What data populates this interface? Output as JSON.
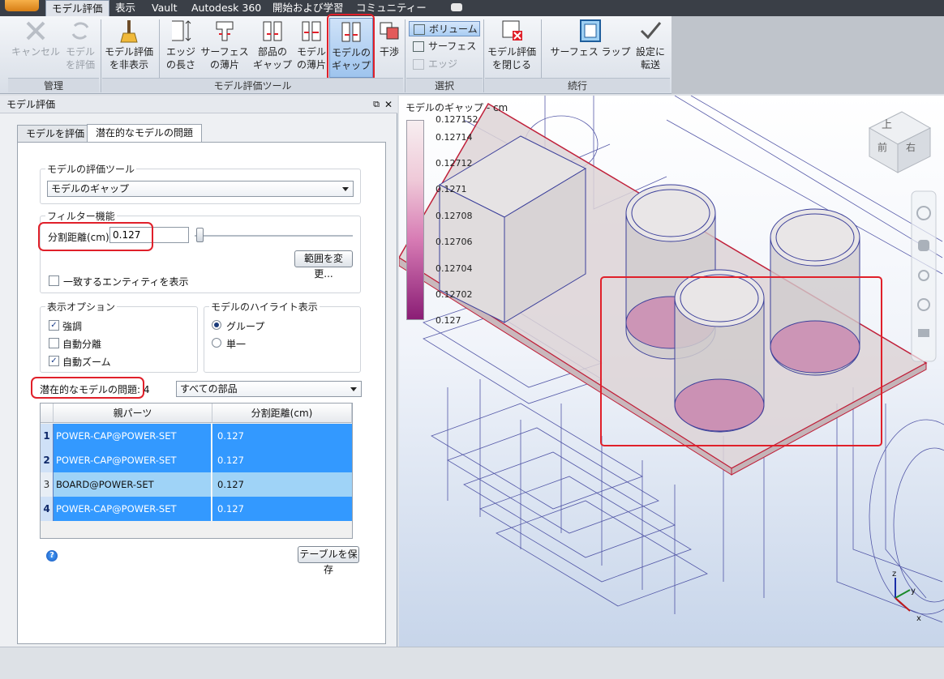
{
  "ribbon": {
    "tabs": [
      "モデル評価",
      "表示",
      "Vault",
      "Autodesk 360",
      "開始および学習",
      "コミュニティー"
    ],
    "buttons": {
      "cancel": "キャンセル",
      "evaluate_model_1": "モデル",
      "evaluate_model_2": "を評価",
      "hide_eval_1": "モデル評価",
      "hide_eval_2": "を非表示",
      "edge_length_1": "エッジ",
      "edge_length_2": "の長さ",
      "surface_thin_1": "サーフェス",
      "surface_thin_2": "の薄片",
      "part_gap_1": "部品の",
      "part_gap_2": "ギャップ",
      "model_thin_1": "モデル",
      "model_thin_2": "の薄片",
      "model_gap_1": "モデルの",
      "model_gap_2": "ギャップ",
      "interference": "干渉",
      "volume": "ボリューム",
      "surface": "サーフェス",
      "edge": "エッジ",
      "close_eval_1": "モデル評価",
      "close_eval_2": "を閉じる",
      "surface_wrap": "サーフェス ラップ",
      "transfer_1": "設定に",
      "transfer_2": "転送"
    },
    "groups": {
      "manage": "管理",
      "tools": "モデル評価ツール",
      "select": "選択",
      "continue": "続行"
    }
  },
  "panel": {
    "title": "モデル評価",
    "tabs": [
      "モデルを評価",
      "潜在的なモデルの問題"
    ],
    "tool_legend": "モデルの評価ツール",
    "tool_value": "モデルのギャップ",
    "filter_legend": "フィルター機能",
    "split_label": "分割距離(cm)",
    "split_value": "0.127",
    "range_button": "範囲を変更...",
    "show_matching": "一致するエンティティを表示",
    "display_legend": "表示オプション",
    "display_options": [
      "強調",
      "自動分離",
      "自動ズーム"
    ],
    "highlight_legend": "モデルのハイライト表示",
    "highlight_options": [
      "グループ",
      "単一"
    ],
    "issues_label": "潜在的なモデルの問題: 4",
    "parts_filter": "すべての部品",
    "table": {
      "headers": [
        "親パーツ",
        "分割距離(cm)"
      ],
      "rows": [
        {
          "num": "1",
          "part": "POWER-CAP@POWER-SET",
          "dist": "0.127"
        },
        {
          "num": "2",
          "part": "POWER-CAP@POWER-SET",
          "dist": "0.127"
        },
        {
          "num": "3",
          "part": "BOARD@POWER-SET",
          "dist": "0.127"
        },
        {
          "num": "4",
          "part": "POWER-CAP@POWER-SET",
          "dist": "0.127"
        }
      ]
    },
    "save_button": "テーブルを保存",
    "help": "?"
  },
  "viewport": {
    "legend_title": "モデルのギャップ - cm",
    "legend_ticks": [
      "0.127152",
      "0.12714",
      "0.12712",
      "0.1271",
      "0.12708",
      "0.12706",
      "0.12704",
      "0.12702",
      "0.127"
    ],
    "viewcube": {
      "top": "上",
      "front": "前",
      "right": "右"
    },
    "axes": {
      "x": "x",
      "y": "y",
      "z": "z"
    }
  },
  "colors": {
    "accent": "#3399ff",
    "highlight": "#e0202a"
  }
}
